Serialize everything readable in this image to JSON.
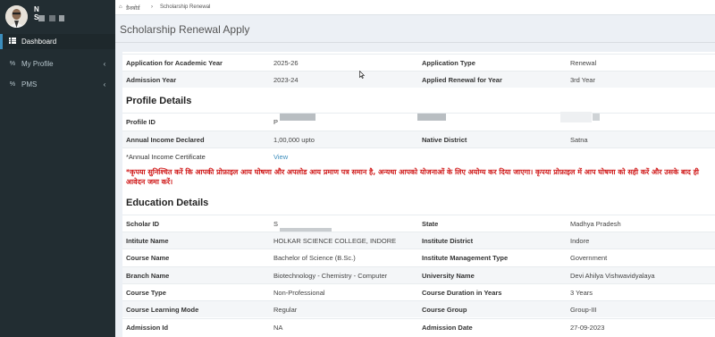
{
  "user": {
    "name_line1": "N",
    "name_line2": "S",
    "name_line3": ""
  },
  "sidebar": {
    "items": [
      {
        "label": "Dashboard",
        "icon": "dashboard-icon",
        "active": true
      },
      {
        "label": "My Profile",
        "icon": "link-icon"
      },
      {
        "label": "PMS",
        "icon": "link-icon"
      }
    ]
  },
  "breadcrumb": {
    "home": "डैशबोर्ड",
    "separator": "›",
    "current": "Scholarship Renewal"
  },
  "page": {
    "title": "Scholarship Renewal Apply"
  },
  "application": {
    "rows": [
      {
        "l1": "Application for Academic Year",
        "v1": "2025-26",
        "l2": "Application Type",
        "v2": "Renewal"
      },
      {
        "l1": "Admission Year",
        "v1": "2023-24",
        "l2": "Applied Renewal for Year",
        "v2": "3rd Year"
      }
    ]
  },
  "profile": {
    "title": "Profile Details",
    "profile_id_label": "Profile ID",
    "profile_id_value": "P",
    "income_label": "Annual Income Declared",
    "income_value": "1,00,000 upto",
    "district_label": "Native District",
    "district_value": "Satna",
    "certificate_label": "*Annual Income Certificate",
    "certificate_link": "View",
    "notice": "*कृपया सुनिश्चित करें कि आपकी प्रोफ़ाइल आय घोषणा और अपलोड आय प्रमाण पत्र समान है, अन्यथा आपको योजनाओं के लिए अयोग्य कर दिया जाएगा। कृपया प्रोफ़ाइल में आप घोषणा को सही करें और उसके बाद ही आवेदन जमा करें।"
  },
  "education": {
    "title": "Education Details",
    "rows": [
      {
        "l1": "Scholar ID",
        "v1": "S",
        "l2": "State",
        "v2": "Madhya Pradesh"
      },
      {
        "l1": "Intitute Name",
        "v1": "HOLKAR SCIENCE COLLEGE, INDORE",
        "l2": "Institute District",
        "v2": "Indore"
      },
      {
        "l1": "Course Name",
        "v1": "Bachelor of Science (B.Sc.)",
        "l2": "Institute Management Type",
        "v2": "Government"
      },
      {
        "l1": "Branch Name",
        "v1": "Biotechnology - Chemistry - Computer",
        "l2": "University Name",
        "v2": "Devi Ahilya Vishwavidyalaya"
      },
      {
        "l1": "Course Type",
        "v1": "Non-Professional",
        "l2": "Course Duration in Years",
        "v2": "3 Years"
      },
      {
        "l1": "Course Learning Mode",
        "v1": "Regular",
        "l2": "Course Group",
        "v2": "Group-III"
      },
      {
        "l1": "Admission Id",
        "v1": "NA",
        "l2": "Admission Date",
        "v2": "27-09-2023"
      }
    ]
  },
  "colors": {
    "sidebar": "#222d32",
    "accent": "#3c8dbc",
    "notice": "#d01a1a"
  }
}
